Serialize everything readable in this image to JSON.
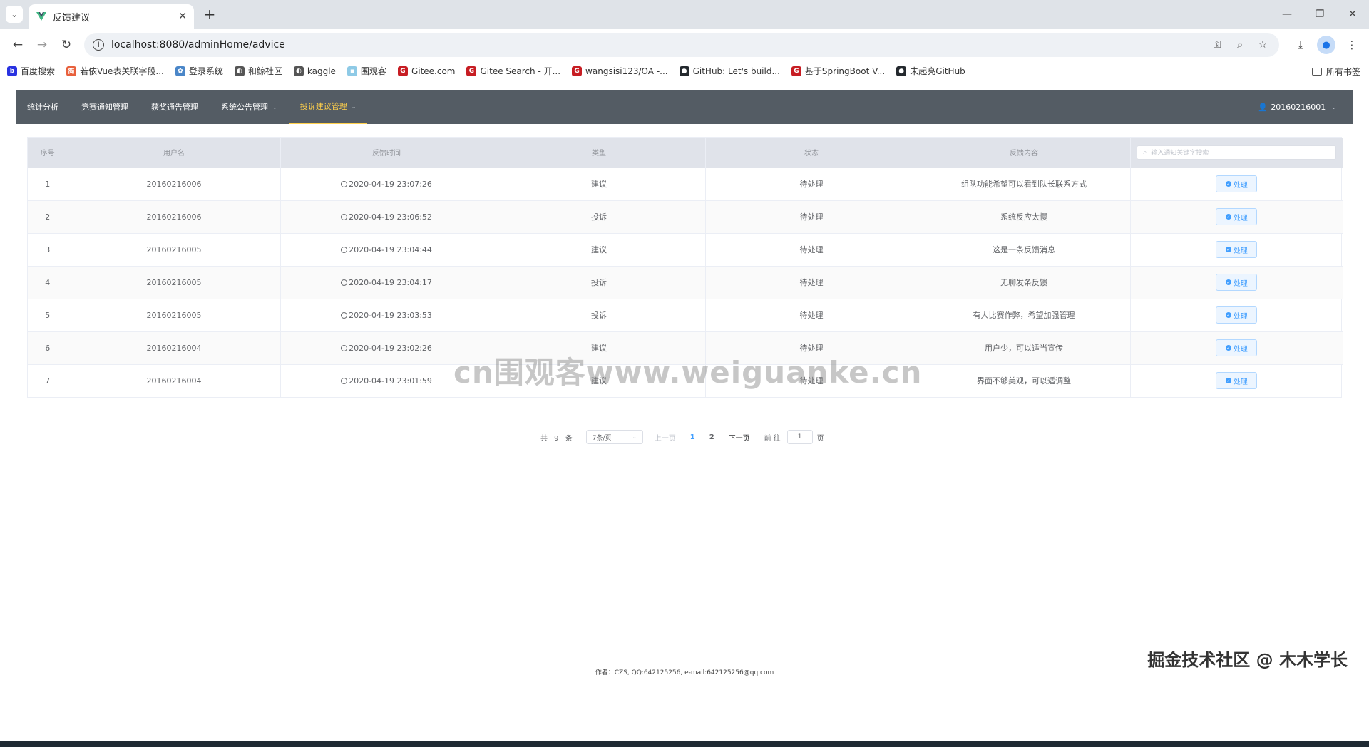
{
  "browser": {
    "tab_title": "反馈建议",
    "url": "localhost:8080/adminHome/advice",
    "bookmarks": [
      {
        "label": "百度搜索",
        "color": "#2932e1",
        "glyph": "b"
      },
      {
        "label": "若依Vue表关联字段...",
        "color": "#e8603c",
        "glyph": "简"
      },
      {
        "label": "登录系统",
        "color": "#4a86c8",
        "glyph": "✿"
      },
      {
        "label": "和鲸社区",
        "color": "#555555",
        "glyph": "◐"
      },
      {
        "label": "kaggle",
        "color": "#555555",
        "glyph": "◐"
      },
      {
        "label": "围观客",
        "color": "#8ecae6",
        "glyph": "▪"
      },
      {
        "label": "Gitee.com",
        "color": "#c71d23",
        "glyph": "G"
      },
      {
        "label": "Gitee Search - 开...",
        "color": "#c71d23",
        "glyph": "G"
      },
      {
        "label": "wangsisi123/OA -...",
        "color": "#c71d23",
        "glyph": "G"
      },
      {
        "label": "GitHub: Let's build...",
        "color": "#24292e",
        "glyph": "●"
      },
      {
        "label": "基于SpringBoot V...",
        "color": "#c71d23",
        "glyph": "G"
      },
      {
        "label": "未起亮GitHub",
        "color": "#24292e",
        "glyph": "●"
      }
    ],
    "all_bookmarks": "所有书签"
  },
  "nav": {
    "items": [
      {
        "label": "统计分析",
        "dropdown": false,
        "active": false
      },
      {
        "label": "竞赛通知管理",
        "dropdown": false,
        "active": false
      },
      {
        "label": "获奖通告管理",
        "dropdown": false,
        "active": false
      },
      {
        "label": "系统公告管理",
        "dropdown": true,
        "active": false
      },
      {
        "label": "投诉建议管理",
        "dropdown": true,
        "active": true
      }
    ],
    "user": "20160216001"
  },
  "table": {
    "headers": [
      "序号",
      "用户名",
      "反馈时间",
      "类型",
      "状态",
      "反馈内容"
    ],
    "search_placeholder": "输入通知关键字搜索",
    "action_label": "处理",
    "rows": [
      {
        "index": "1",
        "user": "20160216006",
        "time": "2020-04-19 23:07:26",
        "type": "建议",
        "status": "待处理",
        "content": "组队功能希望可以看到队长联系方式"
      },
      {
        "index": "2",
        "user": "20160216006",
        "time": "2020-04-19 23:06:52",
        "type": "投诉",
        "status": "待处理",
        "content": "系统反应太慢"
      },
      {
        "index": "3",
        "user": "20160216005",
        "time": "2020-04-19 23:04:44",
        "type": "建议",
        "status": "待处理",
        "content": "这是一条反馈消息"
      },
      {
        "index": "4",
        "user": "20160216005",
        "time": "2020-04-19 23:04:17",
        "type": "投诉",
        "status": "待处理",
        "content": "无聊发条反馈"
      },
      {
        "index": "5",
        "user": "20160216005",
        "time": "2020-04-19 23:03:53",
        "type": "投诉",
        "status": "待处理",
        "content": "有人比赛作弊，希望加强管理"
      },
      {
        "index": "6",
        "user": "20160216004",
        "time": "2020-04-19 23:02:26",
        "type": "建议",
        "status": "待处理",
        "content": "用户少，可以适当宣传"
      },
      {
        "index": "7",
        "user": "20160216004",
        "time": "2020-04-19 23:01:59",
        "type": "建议",
        "status": "待处理",
        "content": "界面不够美观，可以适调整"
      }
    ]
  },
  "pagination": {
    "total": "共 9 条",
    "page_size": "7条/页",
    "prev": "上一页",
    "pages": [
      "1",
      "2"
    ],
    "current": "1",
    "next": "下一页",
    "goto_prefix": "前往",
    "goto_value": "1",
    "goto_suffix": "页"
  },
  "watermark": "cn围观客www.weiguanke.cn",
  "footer": "作者：CZS, QQ:642125256, e-mail:642125256@qq.com",
  "bottom_watermark": "掘金技术社区 @ 木木学长",
  "colors": {
    "nav_bg": "#545c64",
    "nav_active": "#ffd04b",
    "primary": "#409eff"
  }
}
